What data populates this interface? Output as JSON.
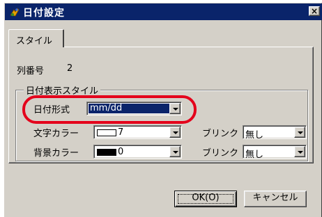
{
  "window": {
    "title": "日付設定",
    "close_glyph": "×"
  },
  "tabs": [
    {
      "label": "スタイル"
    }
  ],
  "row_number": {
    "label": "列番号",
    "value": "2"
  },
  "date_display_style": {
    "group_title": "日付表示スタイル",
    "date_format": {
      "label": "日付形式",
      "value": "mm/dd"
    },
    "text_color": {
      "label": "文字カラー",
      "value": "7",
      "swatch_color": "#ffffff"
    },
    "text_blink": {
      "label": "ブリンク",
      "value": "無し"
    },
    "background_color": {
      "label": "背景カラー",
      "value": "0",
      "swatch_color": "#000000"
    },
    "background_blink": {
      "label": "ブリンク",
      "value": "無し"
    }
  },
  "buttons": {
    "ok": "OK(O)",
    "cancel": "キャンセル"
  },
  "colors": {
    "titlebar": "#0a246a",
    "dialog_face": "#d4d0c8",
    "highlight_ring": "#e4001b",
    "selection": "#0a246a"
  },
  "icons": {
    "app_icon": "app-icon",
    "close_icon": "close-icon",
    "dropdown_icon": "chevron-down-icon"
  }
}
